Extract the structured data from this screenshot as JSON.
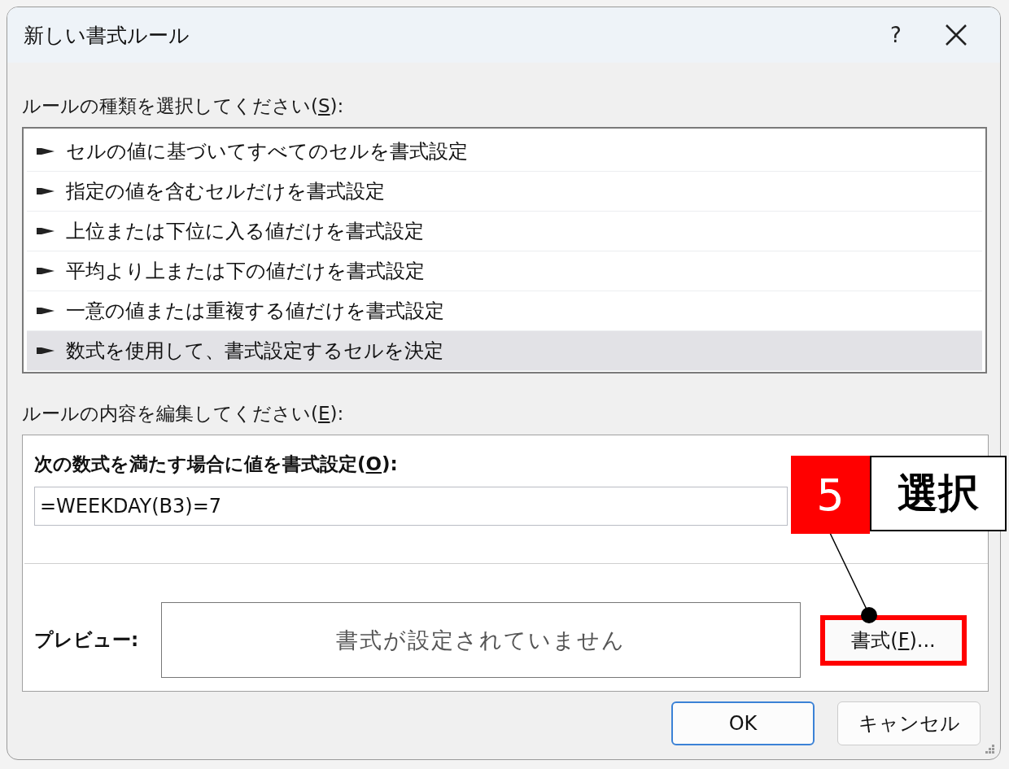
{
  "window": {
    "title": "新しい書式ルール",
    "help": "?"
  },
  "rule_type": {
    "label": {
      "before": "ルールの種類を選択してください(",
      "key": "S",
      "after": "):"
    },
    "items": [
      {
        "text": "セルの値に基づいてすべてのセルを書式設定",
        "selected": false
      },
      {
        "text": "指定の値を含むセルだけを書式設定",
        "selected": false
      },
      {
        "text": "上位または下位に入る値だけを書式設定",
        "selected": false
      },
      {
        "text": "平均より上または下の値だけを書式設定",
        "selected": false
      },
      {
        "text": "一意の値または重複する値だけを書式設定",
        "selected": false
      },
      {
        "text": "数式を使用して、書式設定するセルを決定",
        "selected": true
      }
    ]
  },
  "rule_edit": {
    "label": {
      "before": "ルールの内容を編集してください(",
      "key": "E",
      "after": "):"
    },
    "formula_label": {
      "before": "次の数式を満たす場合に値を書式設定(",
      "key": "O",
      "after": "):"
    },
    "formula": "=WEEKDAY(B3)=7",
    "preview_label": "プレビュー:",
    "preview_text": "書式が設定されていません",
    "format_button": {
      "before": "書式(",
      "key": "F",
      "after": ")...",
      "highlighted": true
    }
  },
  "buttons": [
    {
      "label": "OK",
      "default": true
    },
    {
      "label": "キャンセル",
      "default": false
    }
  ],
  "annotation": {
    "step": "5",
    "text": "選択"
  }
}
